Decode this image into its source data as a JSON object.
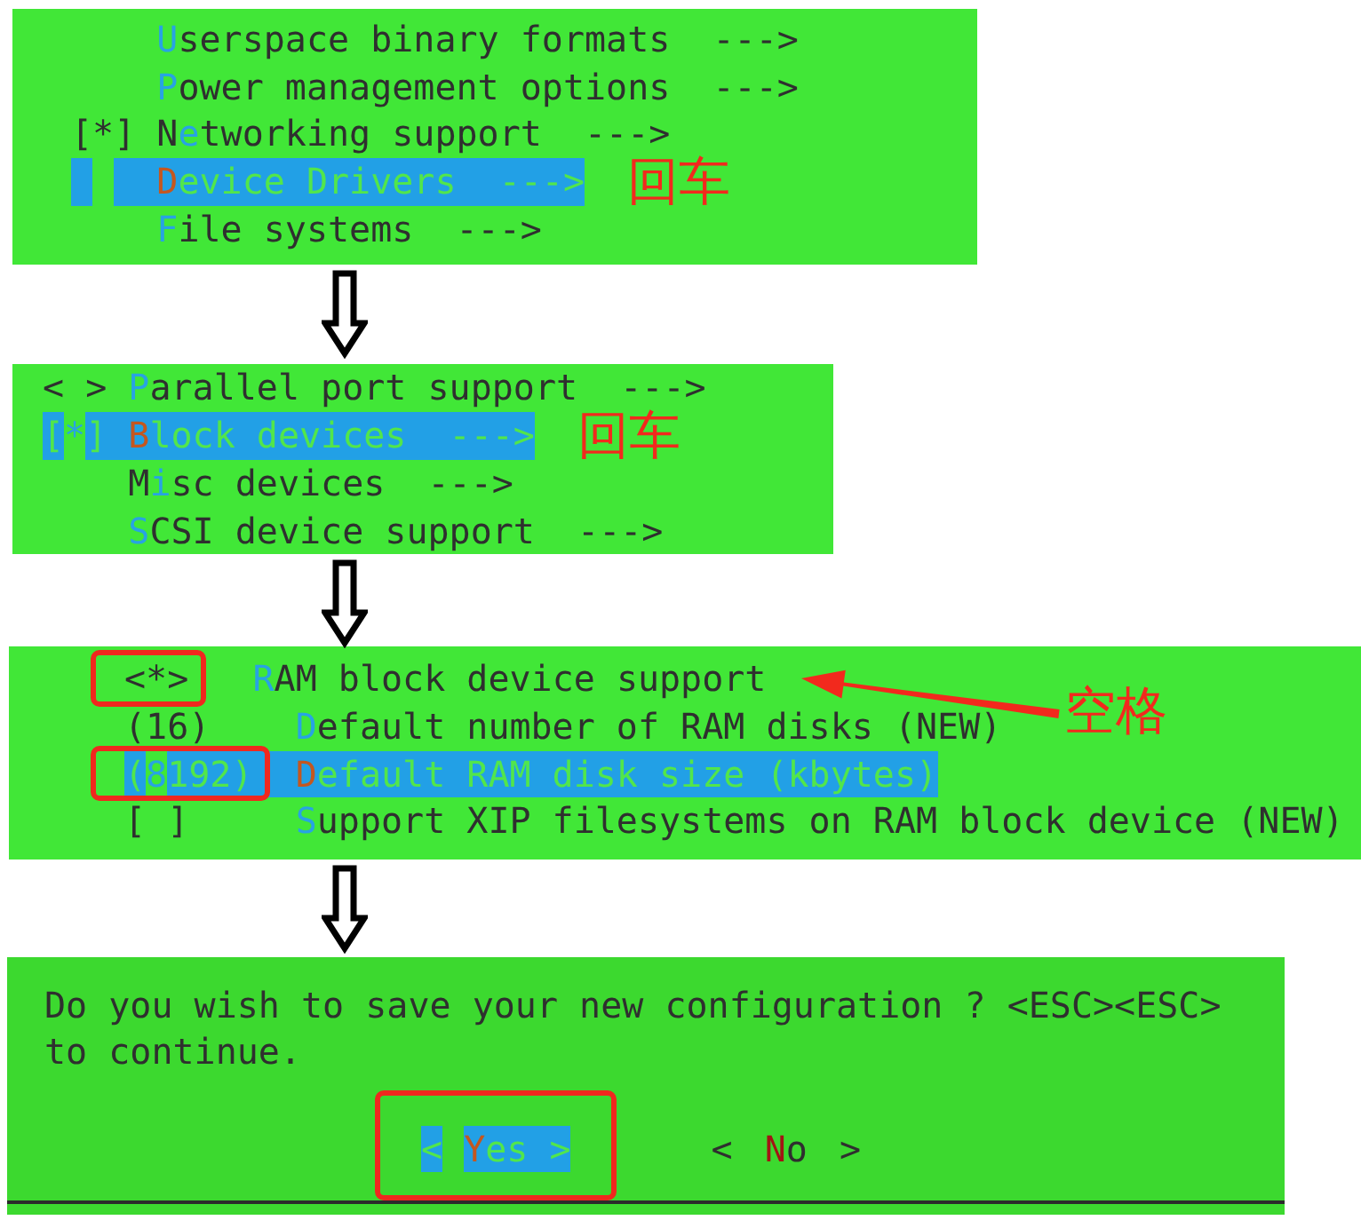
{
  "panels": [
    {
      "kind": "menu",
      "items": [
        {
          "hotkey": "U",
          "label_end": "serspace binary formats",
          "arrow": "--->",
          "selected": false
        },
        {
          "hotkey": "P",
          "label_end": "ower management options",
          "arrow": "--->",
          "selected": false
        },
        {
          "prefix": "[*]",
          "label_start": "N",
          "hotkey": "e",
          "label_end": "tworking support",
          "arrow": "--->",
          "selected": false
        },
        {
          "hotkey": "D",
          "label_end": "evice Drivers",
          "arrow": "--->",
          "selected": true,
          "annotation": {
            "kind": "label",
            "text": "回车"
          }
        },
        {
          "hotkey": "F",
          "label_end": "ile systems",
          "arrow": "--->",
          "selected": false
        }
      ]
    },
    {
      "kind": "menu",
      "items": [
        {
          "prefix": "< >",
          "hotkey": "P",
          "label_end": "arallel port support",
          "arrow": "--->",
          "selected": false
        },
        {
          "prefix": "[*]",
          "hotkey": "B",
          "label_end": "lock devices",
          "arrow": "--->",
          "selected": true,
          "annotation": {
            "kind": "label",
            "text": "回车"
          }
        },
        {
          "label_start": "M",
          "hotkey": "i",
          "label_end": "sc devices",
          "arrow": "--->",
          "selected": false
        },
        {
          "hotkey": "S",
          "label_end": "CSI device support",
          "arrow": "--->",
          "selected": false
        }
      ]
    },
    {
      "kind": "menu",
      "items": [
        {
          "prefix": "<*>",
          "framed": true,
          "hotkey": "R",
          "label_end": "AM block device support",
          "selected": false,
          "annotation": {
            "kind": "arrow",
            "text": "空格"
          },
          "children": [
            {
              "prefix": "(16)",
              "framed": false,
              "hotkey": "D",
              "label_end": "efault number of RAM disks (NEW)",
              "selected": false
            },
            {
              "prefix": "(8192)",
              "framed": true,
              "hotkey": "D",
              "label_end": "efault RAM disk size (kbytes)",
              "selected": true
            },
            {
              "prefix": "[ ]",
              "framed": false,
              "hotkey": "S",
              "label_end": "upport XIP filesystems on RAM block device (NEW)",
              "selected": false
            }
          ]
        }
      ]
    },
    {
      "kind": "dialog",
      "message": "Do you wish to save your new configuration ? <ESC><ESC> to continue.",
      "buttons": [
        {
          "open": "<",
          "hotkey": "Y",
          "label_end": "es",
          "close": ">",
          "selected": true,
          "framed": true
        },
        {
          "open": "<",
          "hotkey": "N",
          "label_end": "o",
          "close": ">",
          "selected": false,
          "framed": false
        }
      ]
    }
  ]
}
